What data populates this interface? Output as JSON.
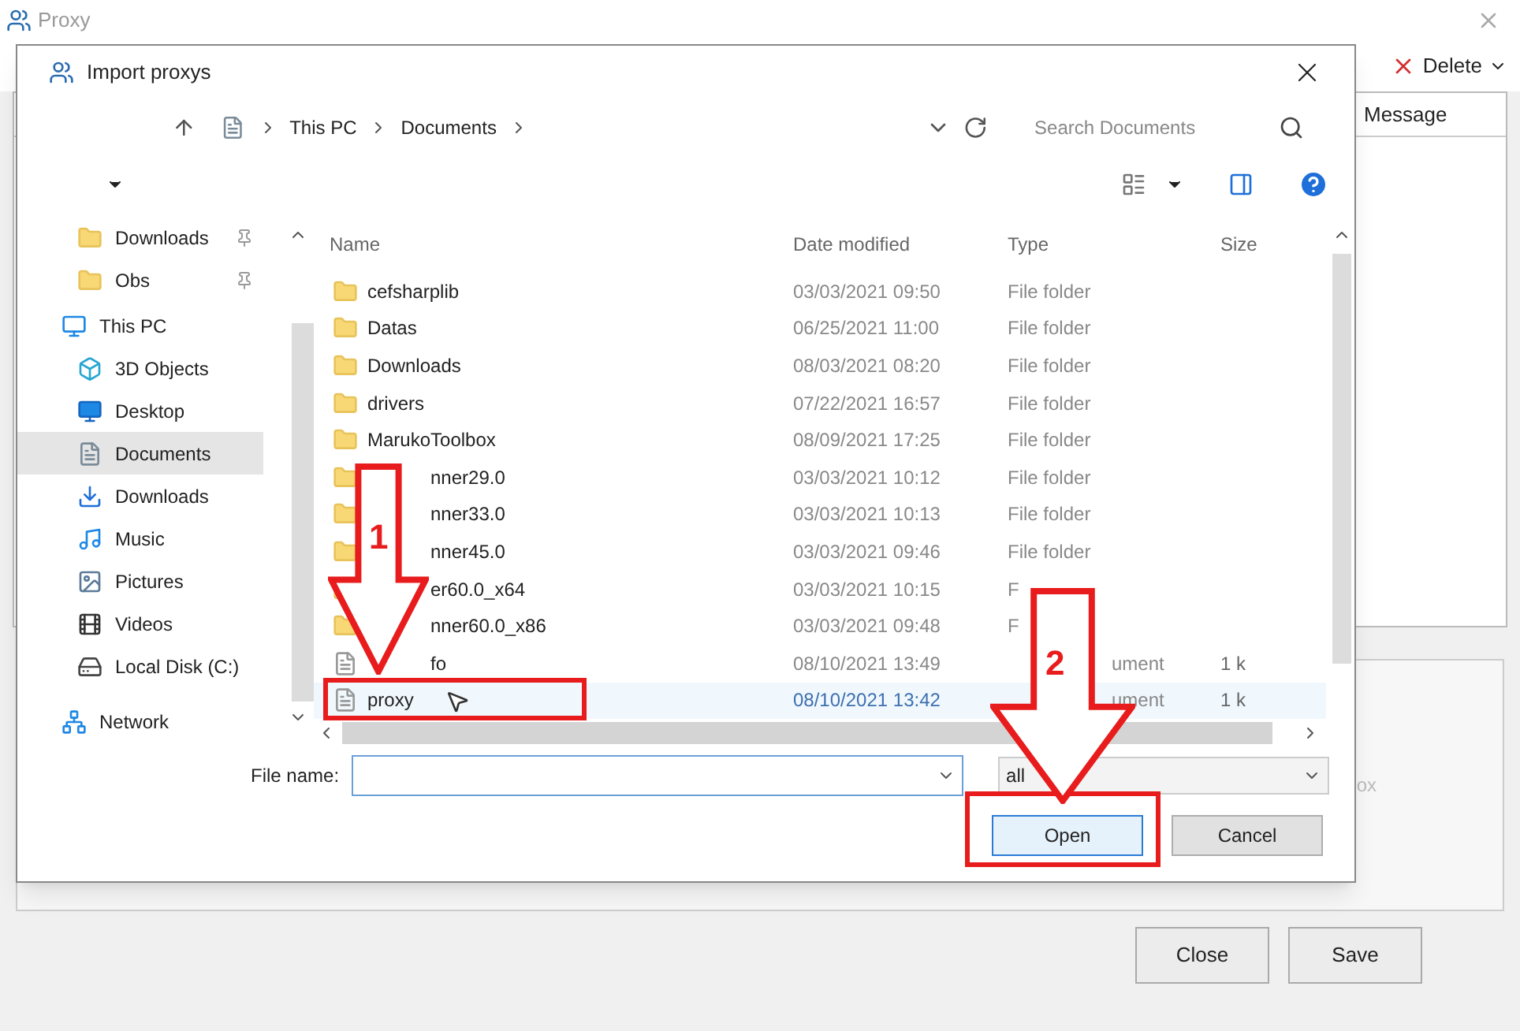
{
  "main_window": {
    "title": "Proxy",
    "toolbar": {
      "delete_button": "Delete"
    },
    "table": {
      "columns": [
        "Message"
      ]
    },
    "hint": "ox",
    "buttons": [
      "Close",
      "Save"
    ]
  },
  "dialog": {
    "title": "Import proxys",
    "breadcrumb": [
      "This PC",
      "Documents"
    ],
    "search": {
      "placeholder": "Search Documents"
    },
    "nav": [
      {
        "label": "Downloads",
        "kind": "quick",
        "pinned": true,
        "selected": false
      },
      {
        "label": "Obs",
        "kind": "quick",
        "pinned": true,
        "selected": false
      },
      {
        "label": "This PC",
        "kind": "pc",
        "pinned": false,
        "selected": false
      },
      {
        "label": "3D Objects",
        "kind": "cube",
        "pinned": false,
        "selected": false
      },
      {
        "label": "Desktop",
        "kind": "desktop",
        "pinned": false,
        "selected": false
      },
      {
        "label": "Documents",
        "kind": "docs",
        "pinned": false,
        "selected": true
      },
      {
        "label": "Downloads",
        "kind": "download",
        "pinned": false,
        "selected": false
      },
      {
        "label": "Music",
        "kind": "music",
        "pinned": false,
        "selected": false
      },
      {
        "label": "Pictures",
        "kind": "pictures",
        "pinned": false,
        "selected": false
      },
      {
        "label": "Videos",
        "kind": "videos",
        "pinned": false,
        "selected": false
      },
      {
        "label": "Local Disk (C:)",
        "kind": "disk",
        "pinned": false,
        "selected": false
      },
      {
        "label": "Network",
        "kind": "network",
        "pinned": false,
        "selected": false
      }
    ],
    "columns": [
      "Name",
      "Date modified",
      "Type",
      "Size"
    ],
    "files": [
      {
        "name": "cefsharplib",
        "date": "03/03/2021 09:50",
        "type": "File folder",
        "kind": "folder",
        "name_covered": false,
        "type_covered": false,
        "selected": false
      },
      {
        "name": "Datas",
        "date": "06/25/2021 11:00",
        "type": "File folder",
        "kind": "folder",
        "name_covered": false,
        "type_covered": false,
        "selected": false
      },
      {
        "name": "Downloads",
        "date": "08/03/2021 08:20",
        "type": "File folder",
        "kind": "folder",
        "name_covered": false,
        "type_covered": false,
        "selected": false
      },
      {
        "name": "drivers",
        "date": "07/22/2021 16:57",
        "type": "File folder",
        "kind": "folder",
        "name_covered": false,
        "type_covered": false,
        "selected": false
      },
      {
        "name": "MarukoToolbox",
        "date": "08/09/2021 17:25",
        "type": "File folder",
        "kind": "folder",
        "name_covered": false,
        "type_covered": false,
        "selected": false
      },
      {
        "name": "nner29.0",
        "date": "03/03/2021 10:12",
        "type": "File folder",
        "kind": "folder",
        "name_covered": true,
        "type_covered": false,
        "selected": false
      },
      {
        "name": "nner33.0",
        "date": "03/03/2021 10:13",
        "type": "File folder",
        "kind": "folder",
        "name_covered": true,
        "type_covered": false,
        "selected": false
      },
      {
        "name": "nner45.0",
        "date": "03/03/2021 09:46",
        "type": "File folder",
        "kind": "folder",
        "name_covered": true,
        "type_covered": false,
        "selected": false
      },
      {
        "name": "er60.0_x64",
        "date": "03/03/2021 10:15",
        "type": "F",
        "kind": "folder",
        "name_covered": true,
        "type_covered": false,
        "selected": false
      },
      {
        "name": "nner60.0_x86",
        "date": "03/03/2021 09:48",
        "type": "F",
        "kind": "folder",
        "name_covered": true,
        "type_covered": false,
        "selected": false
      },
      {
        "name": "fo",
        "date": "08/10/2021 13:49",
        "type": "ument",
        "size": "1 k",
        "kind": "doc",
        "name_covered": true,
        "type_covered": true,
        "selected": false
      },
      {
        "name": "proxy",
        "date": "08/10/2021 13:42",
        "type": "ument",
        "size": "1 k",
        "kind": "doc",
        "name_covered": false,
        "type_covered": true,
        "selected": true
      }
    ],
    "file_name": {
      "label": "File name:"
    },
    "filter": "all",
    "buttons": [
      "Open",
      "Cancel"
    ]
  },
  "annotations": [
    {
      "number": "1"
    },
    {
      "number": "2"
    }
  ]
}
